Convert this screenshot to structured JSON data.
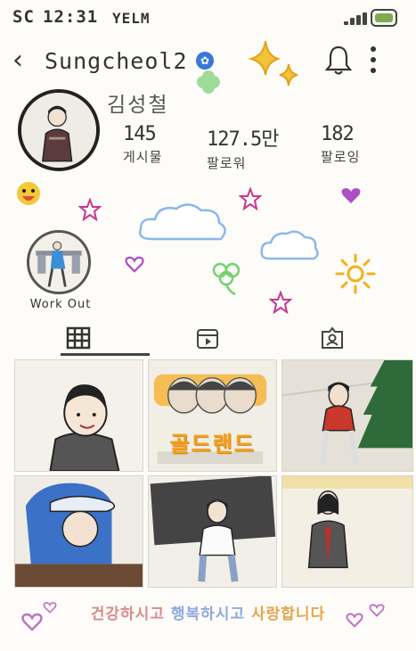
{
  "status_bar": {
    "carrier": "SC",
    "time": "12:31",
    "network": "YELM",
    "battery_color": "#7faa52"
  },
  "header": {
    "username": "Sungcheol2",
    "verified_mark": "✿"
  },
  "profile": {
    "name": "김성철",
    "stats": [
      {
        "value": "145",
        "label": "게시물"
      },
      {
        "value": "127.5만",
        "label": "팔로워"
      },
      {
        "value": "182",
        "label": "팔로잉"
      }
    ]
  },
  "highlights": [
    {
      "label": "Work Out"
    }
  ],
  "tabs": [
    {
      "icon": "grid-icon",
      "active": true
    },
    {
      "icon": "reels-icon",
      "active": false
    },
    {
      "icon": "tagged-icon",
      "active": false
    }
  ],
  "posts": [
    {
      "caption": ""
    },
    {
      "caption": "골드랜드"
    },
    {
      "caption": ""
    },
    {
      "caption": ""
    },
    {
      "caption": ""
    },
    {
      "caption": ""
    }
  ],
  "footer": {
    "part1": "건강하시고",
    "part2": "행복하시고",
    "part3": "사랑합니다"
  },
  "colors": {
    "background": "#fdfcf8",
    "footer_pink": "#d98a8f",
    "footer_blue": "#8fa8df",
    "footer_orange": "#e6a34e"
  }
}
